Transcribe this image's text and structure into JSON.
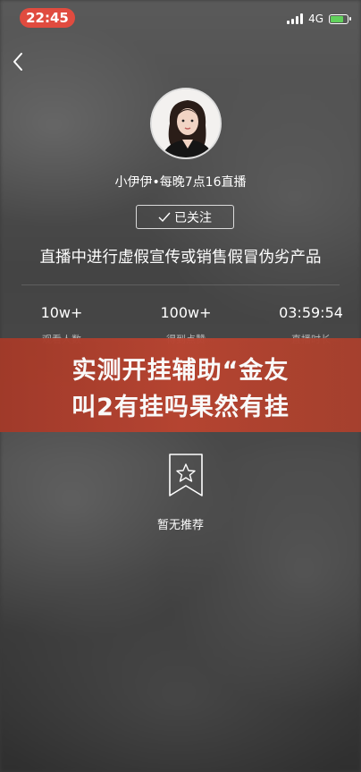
{
  "status_bar": {
    "time": "22:45",
    "network": "4G"
  },
  "anchor": {
    "name": "小伊伊•每晚7点16直播",
    "follow_label": "已关注"
  },
  "notice": "直播中进行虚假宣传或销售假冒伪劣产品",
  "stats": [
    {
      "value": "10w+",
      "label": "观看人数"
    },
    {
      "value": "100w+",
      "label": "得到点赞"
    },
    {
      "value": "03:59:54",
      "label": "直播时长"
    }
  ],
  "banner": {
    "line1": "实测开挂辅助“金友",
    "line2": "叫2有挂吗果然有挂"
  },
  "empty_state": {
    "text": "暂无推荐"
  },
  "colors": {
    "time_pill": "#e04b3f",
    "banner": "#b24030",
    "battery": "#61d15c"
  }
}
